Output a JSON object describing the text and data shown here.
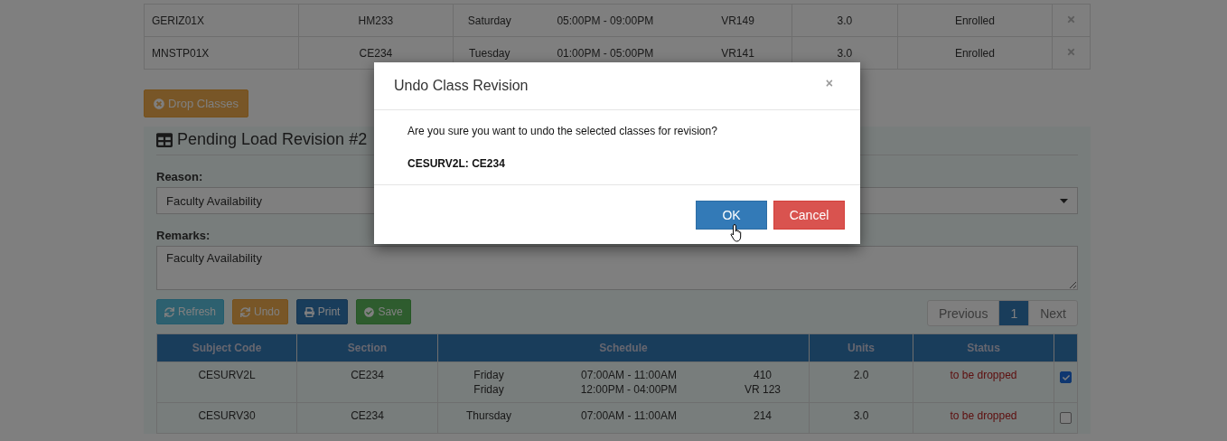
{
  "enrolled_table": {
    "rows": [
      {
        "code": "GERIZ01X",
        "section": "HM233",
        "day": "Saturday",
        "time": "05:00PM - 09:00PM",
        "room": "VR149",
        "units": "3.0",
        "status": "Enrolled"
      },
      {
        "code": "MNSTP01X",
        "section": "CE234",
        "day": "Tuesday",
        "time": "01:00PM - 05:00PM",
        "room": "VR141",
        "units": "3.0",
        "status": "Enrolled"
      }
    ]
  },
  "drop_button": {
    "label": "Drop Classes"
  },
  "panel": {
    "title": "Pending Load Revision #2",
    "reason": {
      "label": "Reason:",
      "value": "Faculty Availability"
    },
    "remarks": {
      "label": "Remarks:",
      "value": "Faculty Availability"
    },
    "actions": [
      {
        "kind": "info",
        "label": "Refresh"
      },
      {
        "kind": "warning",
        "label": "Undo"
      },
      {
        "kind": "primary",
        "label": "Print"
      },
      {
        "kind": "success",
        "label": "Save"
      }
    ],
    "pagination": [
      {
        "label": "Previous",
        "selected": false
      },
      {
        "label": "1",
        "selected": true
      },
      {
        "label": "Next",
        "selected": false
      }
    ],
    "table": {
      "columns": [
        "Subject Code",
        "Section",
        "Schedule",
        "Units",
        "Status"
      ],
      "rows": [
        {
          "code": "CESURV2L",
          "section": "CE234",
          "schedule": [
            {
              "day": "Friday",
              "time": "07:00AM - 11:00AM",
              "room": "410"
            },
            {
              "day": "Friday",
              "time": "12:00PM - 04:00PM",
              "room": "VR 123"
            }
          ],
          "units": "2.0",
          "status": "to be dropped",
          "checked": true
        },
        {
          "code": "CESURV30",
          "section": "CE234",
          "schedule": [
            {
              "day": "Thursday",
              "time": "07:00AM - 11:00AM",
              "room": "214"
            }
          ],
          "units": "3.0",
          "status": "to be dropped",
          "checked": false
        }
      ]
    }
  },
  "dialog": {
    "title": "Undo Class Revision",
    "close": "×",
    "message": "Are you sure you want to undo the selected classes for revision?",
    "detail": "CESURV2L: CE234",
    "buttons": [
      {
        "kind": "primary",
        "label": "OK"
      },
      {
        "kind": "danger",
        "label": "Cancel"
      }
    ]
  }
}
